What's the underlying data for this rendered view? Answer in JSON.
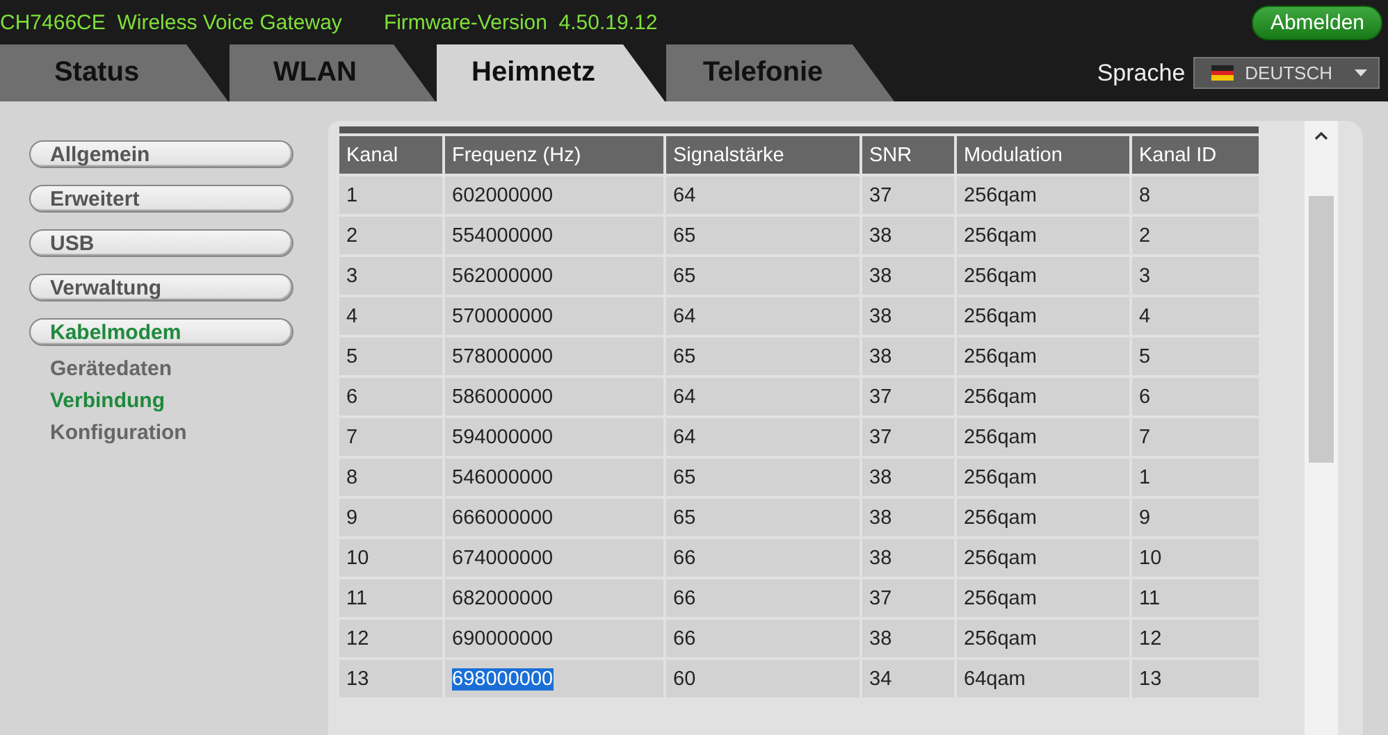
{
  "header": {
    "model": "CH7466CE  Wireless Voice Gateway",
    "firmware": "Firmware-Version  4.50.19.12",
    "logout": "Abmelden"
  },
  "tabs": [
    {
      "label": "Status",
      "selected": false
    },
    {
      "label": "WLAN",
      "selected": false
    },
    {
      "label": "Heimnetz",
      "selected": true
    },
    {
      "label": "Telefonie",
      "selected": false
    }
  ],
  "language": {
    "label": "Sprache",
    "value": "DEUTSCH"
  },
  "sidebar": {
    "items": [
      {
        "label": "Allgemein",
        "selected": false
      },
      {
        "label": "Erweitert",
        "selected": false
      },
      {
        "label": "USB",
        "selected": false
      },
      {
        "label": "Verwaltung",
        "selected": false
      },
      {
        "label": "Kabelmodem",
        "selected": true,
        "children": [
          {
            "label": "Gerätedaten",
            "selected": false
          },
          {
            "label": "Verbindung",
            "selected": true
          },
          {
            "label": "Konfiguration",
            "selected": false
          }
        ]
      }
    ]
  },
  "table": {
    "columns": [
      "Kanal",
      "Frequenz (Hz)",
      "Signalstärke",
      "SNR",
      "Modulation",
      "Kanal ID"
    ],
    "rows": [
      {
        "cells": [
          "1",
          "602000000",
          "64",
          "37",
          "256qam",
          "8"
        ],
        "frequency_selected": false
      },
      {
        "cells": [
          "2",
          "554000000",
          "65",
          "38",
          "256qam",
          "2"
        ],
        "frequency_selected": false
      },
      {
        "cells": [
          "3",
          "562000000",
          "65",
          "38",
          "256qam",
          "3"
        ],
        "frequency_selected": false
      },
      {
        "cells": [
          "4",
          "570000000",
          "64",
          "38",
          "256qam",
          "4"
        ],
        "frequency_selected": false
      },
      {
        "cells": [
          "5",
          "578000000",
          "65",
          "38",
          "256qam",
          "5"
        ],
        "frequency_selected": false
      },
      {
        "cells": [
          "6",
          "586000000",
          "64",
          "37",
          "256qam",
          "6"
        ],
        "frequency_selected": false
      },
      {
        "cells": [
          "7",
          "594000000",
          "64",
          "37",
          "256qam",
          "7"
        ],
        "frequency_selected": false
      },
      {
        "cells": [
          "8",
          "546000000",
          "65",
          "38",
          "256qam",
          "1"
        ],
        "frequency_selected": false
      },
      {
        "cells": [
          "9",
          "666000000",
          "65",
          "38",
          "256qam",
          "9"
        ],
        "frequency_selected": false
      },
      {
        "cells": [
          "10",
          "674000000",
          "66",
          "38",
          "256qam",
          "10"
        ],
        "frequency_selected": false
      },
      {
        "cells": [
          "11",
          "682000000",
          "66",
          "37",
          "256qam",
          "11"
        ],
        "frequency_selected": false
      },
      {
        "cells": [
          "12",
          "690000000",
          "66",
          "38",
          "256qam",
          "12"
        ],
        "frequency_selected": false
      },
      {
        "cells": [
          "13",
          "698000000",
          "60",
          "34",
          "64qam",
          "13"
        ],
        "frequency_selected": true
      }
    ]
  }
}
